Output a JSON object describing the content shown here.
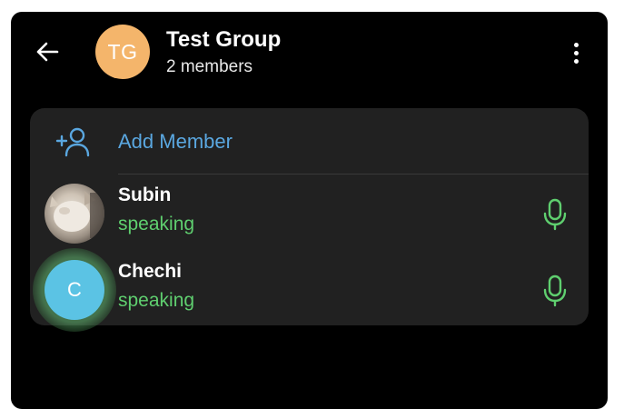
{
  "header": {
    "back_icon": "arrow-left-icon",
    "avatar_initials": "TG",
    "avatar_color": "#f4b56b",
    "title": "Test Group",
    "subtitle": "2 members",
    "menu_icon": "more-vertical-icon"
  },
  "card": {
    "add_member": {
      "icon": "add-user-icon",
      "label": "Add Member",
      "color": "#5aa7e0"
    },
    "members": [
      {
        "name": "Subin",
        "status": "speaking",
        "avatar": "photo",
        "mic_icon": "microphone-icon"
      },
      {
        "name": "Chechi",
        "status": "speaking",
        "avatar_letter": "C",
        "avatar_color": "#5bc3e4",
        "mic_icon": "microphone-icon"
      }
    ],
    "status_color": "#5fcf6f"
  }
}
